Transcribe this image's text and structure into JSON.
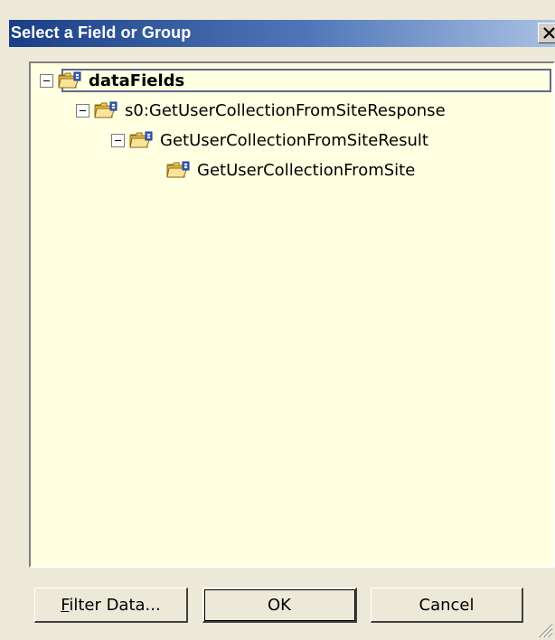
{
  "window": {
    "title": "Select a Field or Group",
    "close_icon": "close-icon"
  },
  "tree": {
    "nodes": [
      {
        "label": "dataFields",
        "level": 0,
        "expanded": true,
        "selected": true,
        "icon": "folder-icon"
      },
      {
        "label": "s0:GetUserCollectionFromSiteResponse",
        "level": 1,
        "expanded": true,
        "icon": "folder-icon"
      },
      {
        "label": "GetUserCollectionFromSiteResult",
        "level": 2,
        "expanded": true,
        "icon": "folder-icon"
      },
      {
        "label": "GetUserCollectionFromSite",
        "level": 3,
        "expanded": false,
        "icon": "folder-icon"
      }
    ]
  },
  "buttons": {
    "filter_label": "Filter Data...",
    "filter_mnemonic": "F",
    "filter_rest": "ilter Data...",
    "ok_label": "OK",
    "cancel_label": "Cancel"
  },
  "colors": {
    "title_start": "#1b3f86",
    "title_end": "#a9c0e3",
    "tree_background": "#ffffe1",
    "dialog_background": "#ece9d8"
  }
}
